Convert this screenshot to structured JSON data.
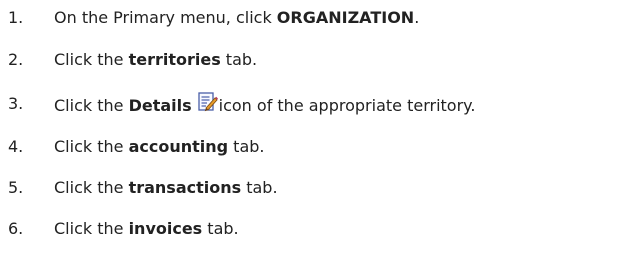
{
  "steps": [
    {
      "number": "1.",
      "before": "On the Primary menu, click ",
      "emphasis": "ORGANIZATION",
      "after": "."
    },
    {
      "number": "2.",
      "before": "Click the ",
      "emphasis": "territories",
      "after": " tab."
    },
    {
      "number": "3.",
      "before": "Click the ",
      "emphasis": "Details",
      "icon": "details-edit-icon",
      "after": "icon of the appropriate territory."
    },
    {
      "number": "4.",
      "before": "Click the ",
      "emphasis": "accounting",
      "after": " tab."
    },
    {
      "number": "5.",
      "before": "Click the ",
      "emphasis": "transactions",
      "after": " tab."
    },
    {
      "number": "6.",
      "before": "Click the ",
      "emphasis": "invoices",
      "after": " tab."
    }
  ],
  "colors": {
    "text": "#222222",
    "background": "#ffffff"
  }
}
